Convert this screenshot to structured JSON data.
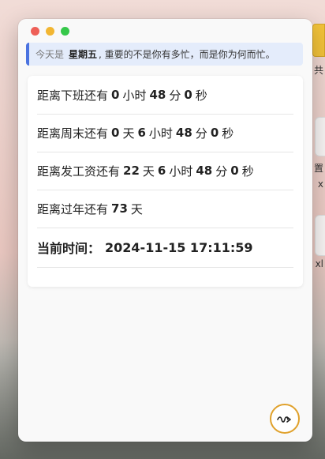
{
  "banner": {
    "prefix": "今天是",
    "weekday": "星期五",
    "message": ", 重要的不是你有多忙，而是你为何而忙。"
  },
  "countdowns": {
    "off_work": {
      "label": "距离下班还有",
      "hours": "0",
      "hours_unit": "小时",
      "minutes": "48",
      "minutes_unit": "分",
      "seconds": "0",
      "seconds_unit": "秒"
    },
    "weekend": {
      "label": "距离周末还有",
      "days": "0",
      "days_unit": "天",
      "hours": "6",
      "hours_unit": "小时",
      "minutes": "48",
      "minutes_unit": "分",
      "seconds": "0",
      "seconds_unit": "秒"
    },
    "payday": {
      "label": "距离发工资还有",
      "days": "22",
      "days_unit": "天",
      "hours": "6",
      "hours_unit": "小时",
      "minutes": "48",
      "minutes_unit": "分",
      "seconds": "0",
      "seconds_unit": "秒"
    },
    "new_year": {
      "label": "距离过年还有",
      "days": "73",
      "days_unit": "天"
    }
  },
  "current_time": {
    "label": "当前时间：",
    "value": "2024-11-15 17:11:59"
  },
  "background": {
    "edge_texts": [
      "共",
      "置",
      "x",
      "xl"
    ]
  },
  "colors": {
    "accent": "#4b73e0",
    "fab_border": "#e0a12b",
    "close": "#ee5f57",
    "minimize": "#f2b632",
    "zoom": "#36c84a"
  },
  "icons": {
    "fab": "wave-arrow-icon"
  }
}
